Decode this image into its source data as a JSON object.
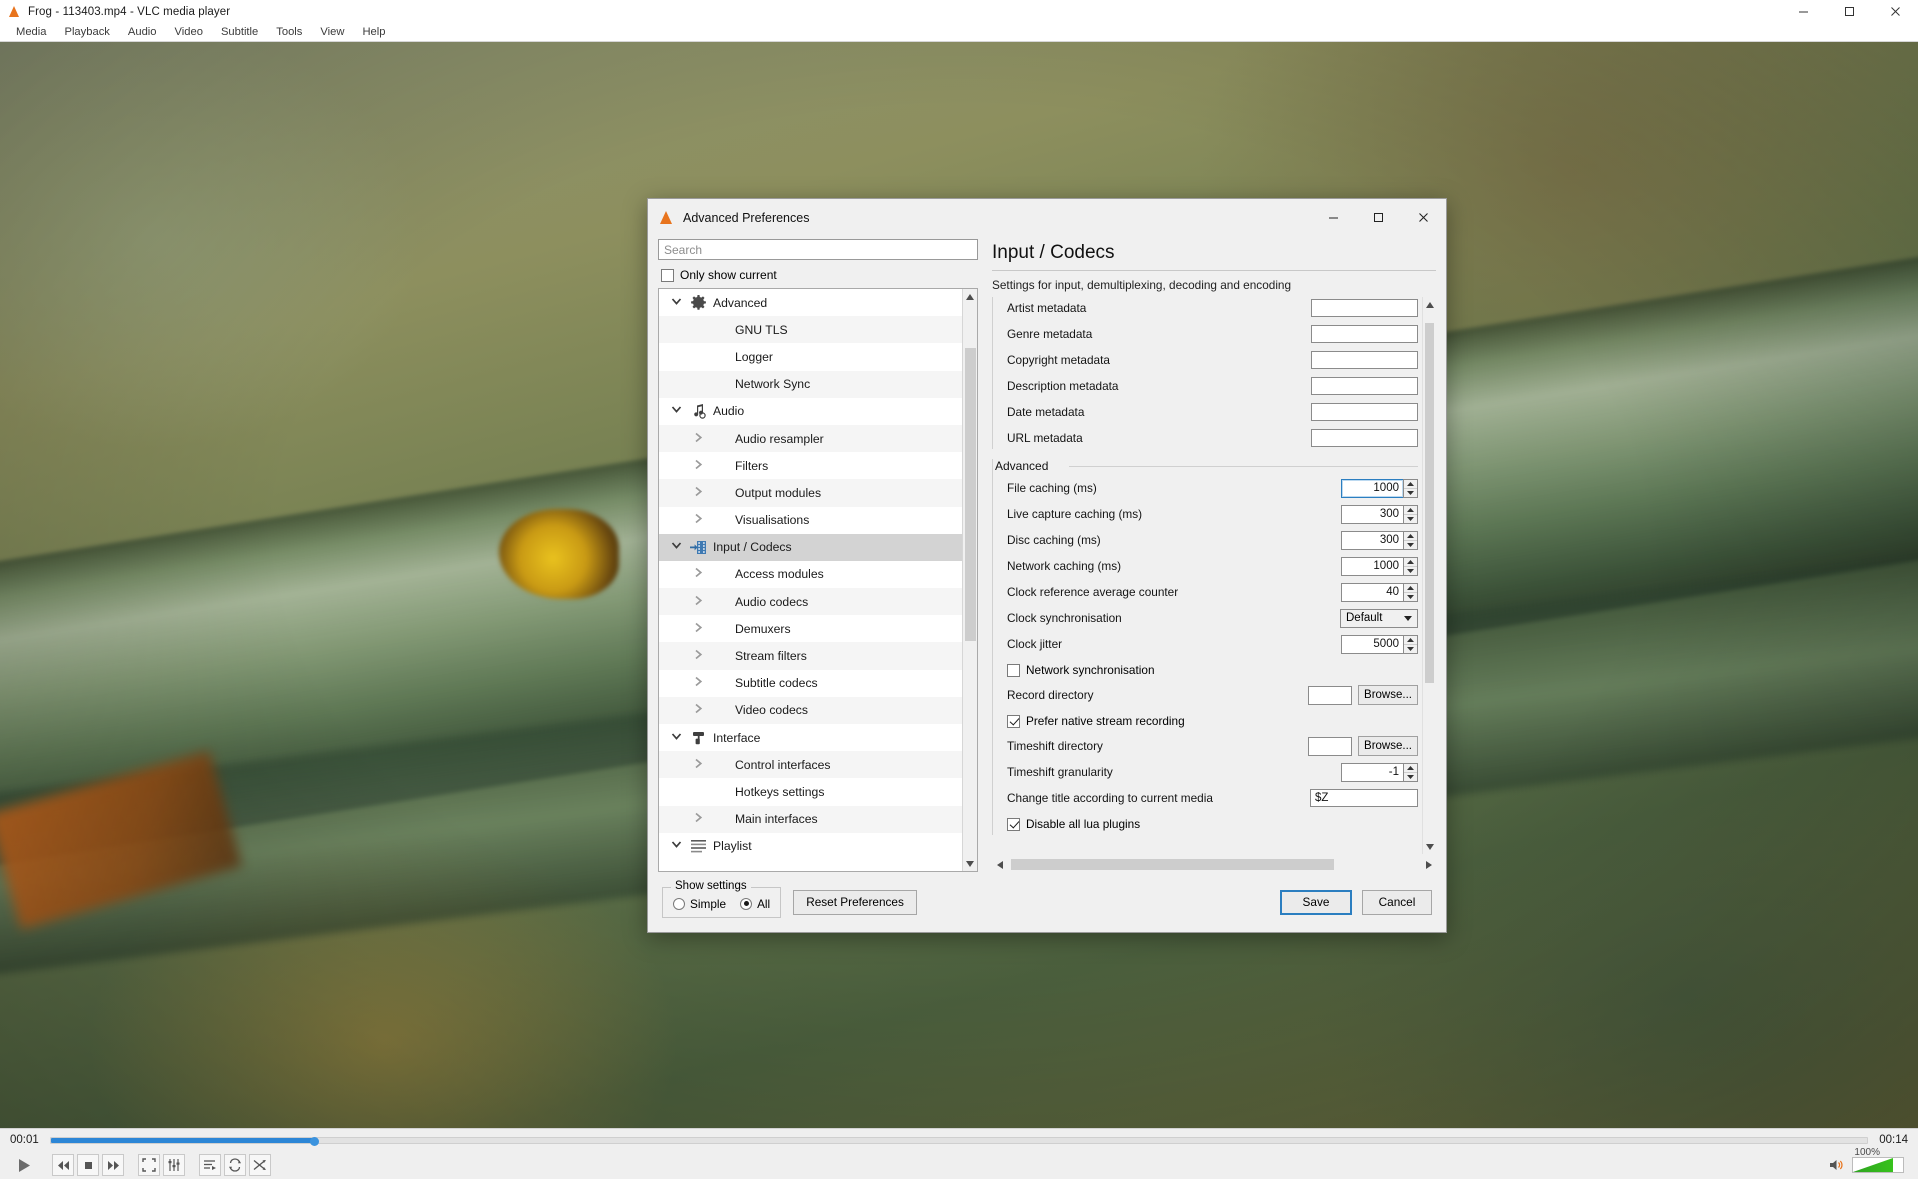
{
  "vlc": {
    "title": "Frog - 113403.mp4 - VLC media player",
    "icon": "vlc-cone-icon",
    "window_controls": [
      {
        "name": "minimize-icon",
        "label": "–"
      },
      {
        "name": "maximize-icon",
        "label": "□"
      },
      {
        "name": "close-icon",
        "label": "✕"
      }
    ],
    "menu": [
      "Media",
      "Playback",
      "Audio",
      "Video",
      "Subtitle",
      "Tools",
      "View",
      "Help"
    ],
    "player": {
      "elapsed": "00:01",
      "total": "00:14",
      "progress_percent": 14.5,
      "volume_label": "100%",
      "buttons": [
        {
          "name": "play-button",
          "glyph": "play"
        },
        {
          "name": "previous-button",
          "glyph": "prev"
        },
        {
          "name": "stop-button",
          "glyph": "stop"
        },
        {
          "name": "next-button",
          "glyph": "next"
        },
        {
          "name": "fullscreen-button",
          "glyph": "fullscreen"
        },
        {
          "name": "extended-settings-button",
          "glyph": "sliders"
        },
        {
          "name": "playlist-button",
          "glyph": "playlist"
        },
        {
          "name": "loop-button",
          "glyph": "loop"
        },
        {
          "name": "shuffle-button",
          "glyph": "shuffle"
        }
      ]
    }
  },
  "dialog": {
    "title": "Advanced Preferences",
    "window_controls": [
      {
        "name": "minimize-icon",
        "label": "—"
      },
      {
        "name": "maximize-icon",
        "label": "□"
      },
      {
        "name": "close-icon",
        "label": "✕"
      }
    ],
    "search": {
      "value": "",
      "placeholder": "Search"
    },
    "only_show_current": {
      "label": "Only show current",
      "checked": false
    },
    "tree": [
      {
        "label": "Advanced",
        "level": 0,
        "state": "expanded",
        "icon": "gear-icon",
        "selected": false
      },
      {
        "label": "GNU TLS",
        "level": 1,
        "state": "leaf",
        "icon": "",
        "selected": false
      },
      {
        "label": "Logger",
        "level": 1,
        "state": "leaf",
        "icon": "",
        "selected": false
      },
      {
        "label": "Network Sync",
        "level": 1,
        "state": "leaf",
        "icon": "",
        "selected": false
      },
      {
        "label": "Audio",
        "level": 0,
        "state": "expanded",
        "icon": "music-note-icon",
        "selected": false
      },
      {
        "label": "Audio resampler",
        "level": 1,
        "state": "collapsed",
        "icon": "",
        "selected": false
      },
      {
        "label": "Filters",
        "level": 1,
        "state": "collapsed",
        "icon": "",
        "selected": false
      },
      {
        "label": "Output modules",
        "level": 1,
        "state": "collapsed",
        "icon": "",
        "selected": false
      },
      {
        "label": "Visualisations",
        "level": 1,
        "state": "collapsed",
        "icon": "",
        "selected": false
      },
      {
        "label": "Input / Codecs",
        "level": 0,
        "state": "expanded",
        "icon": "film-input-icon",
        "selected": true
      },
      {
        "label": "Access modules",
        "level": 1,
        "state": "collapsed",
        "icon": "",
        "selected": false
      },
      {
        "label": "Audio codecs",
        "level": 1,
        "state": "collapsed",
        "icon": "",
        "selected": false
      },
      {
        "label": "Demuxers",
        "level": 1,
        "state": "collapsed",
        "icon": "",
        "selected": false
      },
      {
        "label": "Stream filters",
        "level": 1,
        "state": "collapsed",
        "icon": "",
        "selected": false
      },
      {
        "label": "Subtitle codecs",
        "level": 1,
        "state": "collapsed",
        "icon": "",
        "selected": false
      },
      {
        "label": "Video codecs",
        "level": 1,
        "state": "collapsed",
        "icon": "",
        "selected": false
      },
      {
        "label": "Interface",
        "level": 0,
        "state": "expanded",
        "icon": "paint-roller-icon",
        "selected": false
      },
      {
        "label": "Control interfaces",
        "level": 1,
        "state": "collapsed",
        "icon": "",
        "selected": false
      },
      {
        "label": "Hotkeys settings",
        "level": 1,
        "state": "leaf",
        "icon": "",
        "selected": false
      },
      {
        "label": "Main interfaces",
        "level": 1,
        "state": "collapsed",
        "icon": "",
        "selected": false
      },
      {
        "label": "Playlist",
        "level": 0,
        "state": "expanded",
        "icon": "list-icon",
        "selected": false
      }
    ],
    "panel": {
      "title": "Input / Codecs",
      "description": "Settings for input, demultiplexing, decoding and encoding",
      "metadata_fields": [
        {
          "label": "Artist metadata",
          "value": ""
        },
        {
          "label": "Genre metadata",
          "value": ""
        },
        {
          "label": "Copyright metadata",
          "value": ""
        },
        {
          "label": "Description metadata",
          "value": ""
        },
        {
          "label": "Date metadata",
          "value": ""
        },
        {
          "label": "URL metadata",
          "value": ""
        }
      ],
      "advanced_group_label": "Advanced",
      "advanced_fields": [
        {
          "label": "File caching (ms)",
          "value": "1000",
          "type": "spin",
          "focused": true
        },
        {
          "label": "Live capture caching (ms)",
          "value": "300",
          "type": "spin",
          "focused": false
        },
        {
          "label": "Disc caching (ms)",
          "value": "300",
          "type": "spin",
          "focused": false
        },
        {
          "label": "Network caching (ms)",
          "value": "1000",
          "type": "spin",
          "focused": false
        },
        {
          "label": "Clock reference average counter",
          "value": "40",
          "type": "spin",
          "focused": false
        },
        {
          "label": "Clock synchronisation",
          "value": "Default",
          "type": "combo",
          "focused": false
        },
        {
          "label": "Clock jitter",
          "value": "5000",
          "type": "spin",
          "focused": false
        }
      ],
      "network_sync": {
        "label": "Network synchronisation",
        "checked": false
      },
      "record_directory": {
        "label": "Record directory",
        "value": "",
        "button": "Browse..."
      },
      "prefer_native": {
        "label": "Prefer native stream recording",
        "checked": true
      },
      "timeshift_directory": {
        "label": "Timeshift directory",
        "value": "",
        "button": "Browse..."
      },
      "timeshift_granularity": {
        "label": "Timeshift granularity",
        "value": "-1"
      },
      "change_title": {
        "label": "Change title according to current media",
        "value": "$Z"
      },
      "disable_lua": {
        "label": "Disable all lua plugins",
        "checked": true
      }
    },
    "footer": {
      "show_settings_legend": "Show settings",
      "options": [
        {
          "label": "Simple",
          "selected": false
        },
        {
          "label": "All",
          "selected": true
        }
      ],
      "reset_label": "Reset Preferences",
      "save_label": "Save",
      "cancel_label": "Cancel"
    }
  },
  "colors": {
    "accent": "#2b7ec0",
    "seek": "#2c86d6",
    "volume": "#37c21c",
    "selection": "#d3d3d3"
  }
}
